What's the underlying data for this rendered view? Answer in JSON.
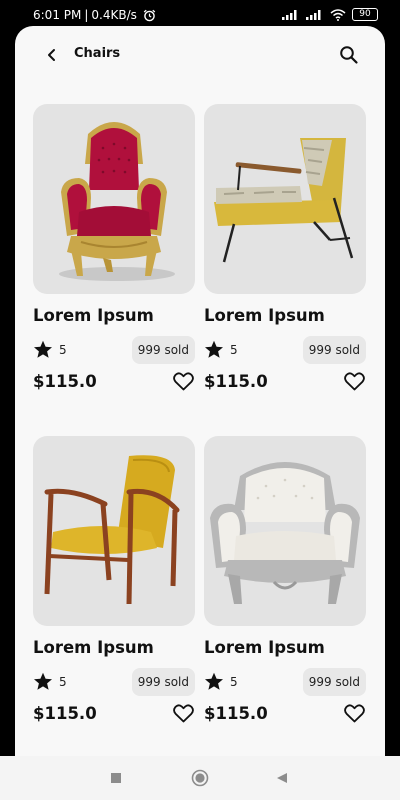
{
  "status_bar": {
    "time": "6:01 PM",
    "separator": "|",
    "network_speed": "0.4KB/s",
    "alarm_icon": "alarm-icon",
    "signal_icon": "signal-icon",
    "wifi_icon": "wifi-icon",
    "battery_level": "90"
  },
  "header": {
    "back_icon": "chevron-left-icon",
    "title": "Chairs",
    "search_icon": "search-icon"
  },
  "products": [
    {
      "title": "Lorem Ipsum",
      "rating": "5",
      "sold": "999 sold",
      "price": "$115.0",
      "image": "red-velvet-baroque-armchair",
      "favorited": false
    },
    {
      "title": "Lorem Ipsum",
      "rating": "5",
      "sold": "999 sold",
      "price": "$115.0",
      "image": "mustard-lounge-chair",
      "favorited": false
    },
    {
      "title": "Lorem Ipsum",
      "rating": "5",
      "sold": "999 sold",
      "price": "$115.0",
      "image": "yellow-wooden-armchair",
      "favorited": false
    },
    {
      "title": "Lorem Ipsum",
      "rating": "5",
      "sold": "999 sold",
      "price": "$115.0",
      "image": "white-baroque-armchair",
      "favorited": false
    }
  ],
  "nav_bar": {
    "recents_icon": "square-recents-icon",
    "home_icon": "circle-home-icon",
    "back_icon": "triangle-back-icon"
  },
  "colors": {
    "background": "#f8f8f8",
    "card_image_bg": "#e3e3e3",
    "badge_bg": "#e8e8e8",
    "text": "#111111"
  }
}
